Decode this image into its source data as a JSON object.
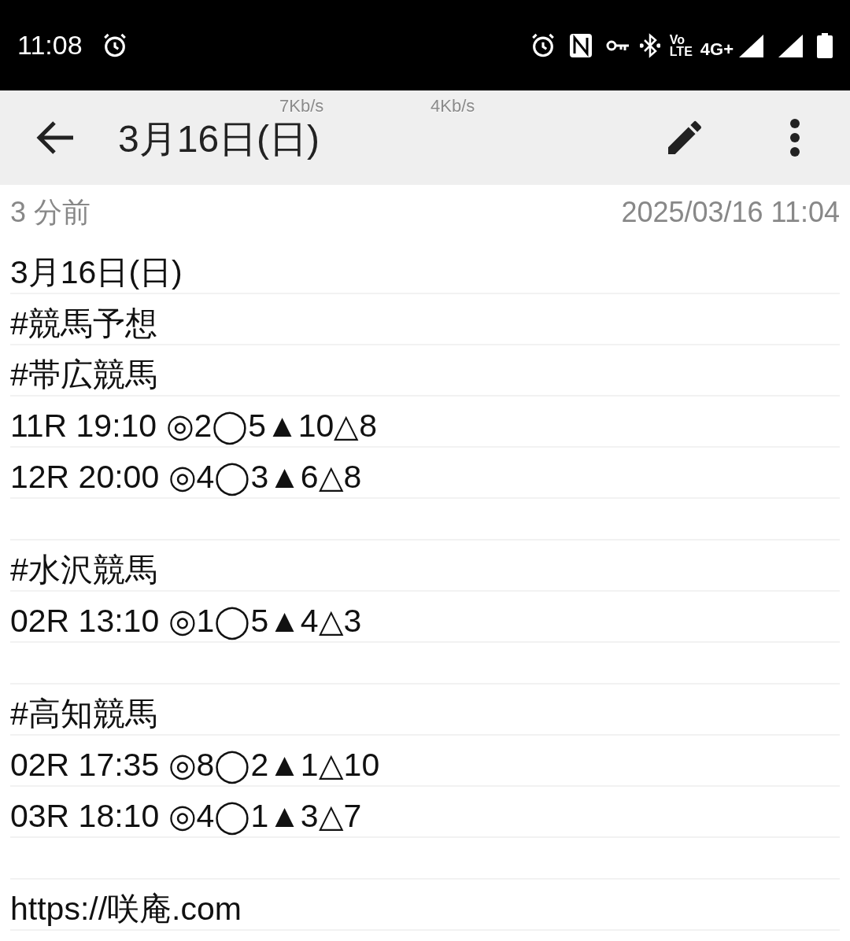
{
  "status_bar": {
    "time": "11:08",
    "network": "4G+",
    "volte_top": "Vo",
    "volte_bottom": "LTE"
  },
  "speed_overlays": [
    "7Kb/s",
    "4Kb/s"
  ],
  "toolbar": {
    "title": "3月16日(日)"
  },
  "meta": {
    "relative_time": "3 分前",
    "timestamp": "2025/03/16 11:04"
  },
  "note_lines": [
    {
      "kind": "text",
      "text": "3月16日(日)"
    },
    {
      "kind": "text",
      "text": "#競馬予想"
    },
    {
      "kind": "text",
      "text": "#帯広競馬"
    },
    {
      "kind": "text",
      "text": "11R 19:10 ◎2◯5▲10△8"
    },
    {
      "kind": "text",
      "text": "12R 20:00 ◎4◯3▲6△8"
    },
    {
      "kind": "blank"
    },
    {
      "kind": "text",
      "text": "#水沢競馬"
    },
    {
      "kind": "text",
      "text": "02R 13:10 ◎1◯5▲4△3"
    },
    {
      "kind": "blank"
    },
    {
      "kind": "text",
      "text": "#高知競馬"
    },
    {
      "kind": "text",
      "text": "02R 17:35 ◎8◯2▲1△10"
    },
    {
      "kind": "text",
      "text": "03R 18:10 ◎4◯1▲3△7"
    },
    {
      "kind": "blank"
    },
    {
      "kind": "link",
      "text": "https://咲庵.com"
    }
  ]
}
